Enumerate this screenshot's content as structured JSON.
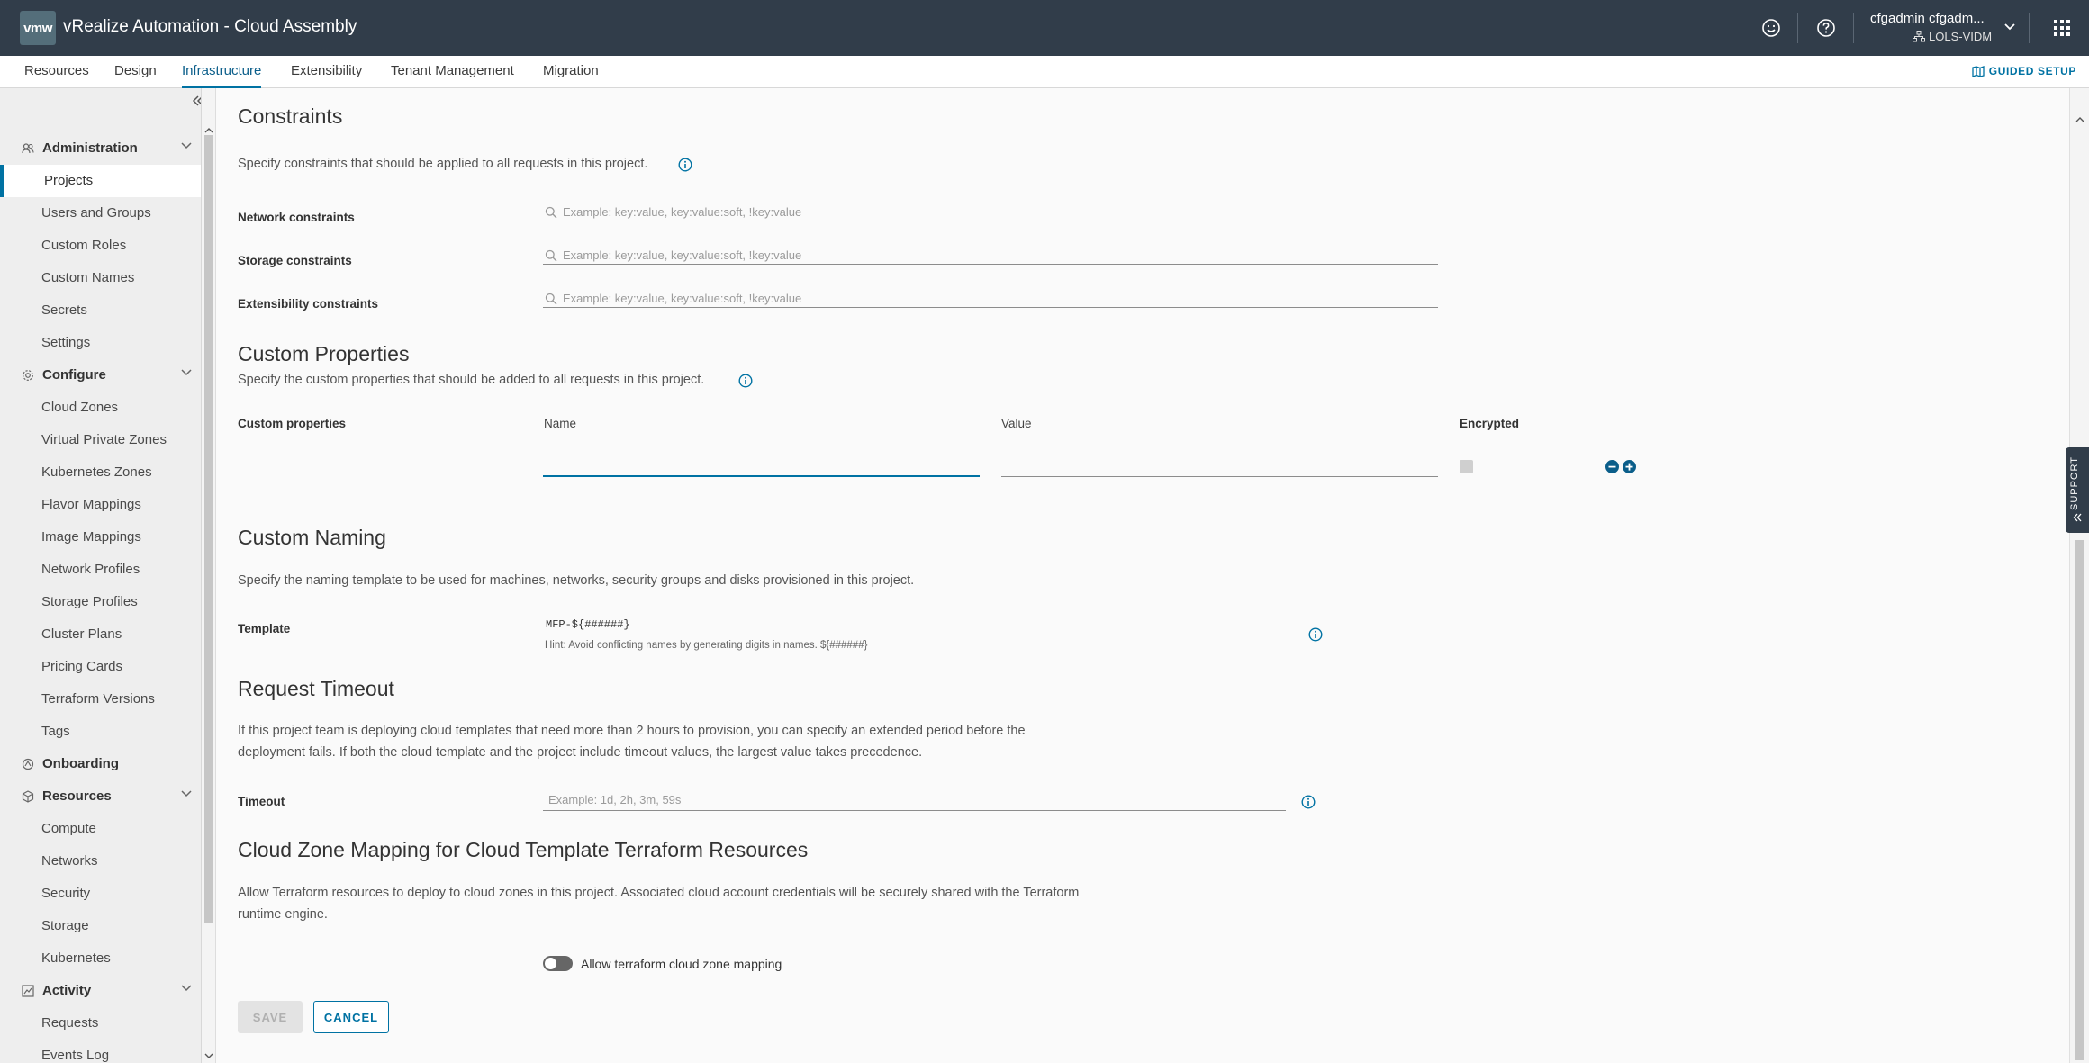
{
  "header": {
    "logo": "vmw",
    "title": "vRealize Automation - Cloud Assembly",
    "user_name": "cfgadmin cfgadm...",
    "user_org": "LOLS-VIDM"
  },
  "nav": {
    "tabs": [
      "Resources",
      "Design",
      "Infrastructure",
      "Extensibility",
      "Tenant Management",
      "Migration"
    ],
    "active": "Infrastructure",
    "guided_setup": "GUIDED SETUP"
  },
  "sidebar": {
    "administration": {
      "label": "Administration",
      "items": [
        "Projects",
        "Users and Groups",
        "Custom Roles",
        "Custom Names",
        "Secrets",
        "Settings"
      ]
    },
    "configure": {
      "label": "Configure",
      "items": [
        "Cloud Zones",
        "Virtual Private Zones",
        "Kubernetes Zones",
        "Flavor Mappings",
        "Image Mappings",
        "Network Profiles",
        "Storage Profiles",
        "Cluster Plans",
        "Pricing Cards",
        "Terraform Versions",
        "Tags"
      ]
    },
    "onboarding": {
      "label": "Onboarding"
    },
    "resources": {
      "label": "Resources",
      "items": [
        "Compute",
        "Networks",
        "Security",
        "Storage",
        "Kubernetes"
      ]
    },
    "activity": {
      "label": "Activity",
      "items": [
        "Requests",
        "Events Log"
      ]
    }
  },
  "constraints": {
    "title": "Constraints",
    "desc": "Specify constraints that should be applied to all requests in this project.",
    "network_label": "Network constraints",
    "storage_label": "Storage constraints",
    "extensibility_label": "Extensibility constraints",
    "placeholder": "Example: key:value, key:value:soft, !key:value"
  },
  "custom_properties": {
    "title": "Custom Properties",
    "desc": "Specify the custom properties that should be added to all requests in this project.",
    "label": "Custom properties",
    "col_name": "Name",
    "col_value": "Value",
    "col_encrypted": "Encrypted"
  },
  "custom_naming": {
    "title": "Custom Naming",
    "desc": "Specify the naming template to be used for machines, networks, security groups and disks provisioned in this project.",
    "template_label": "Template",
    "template_value": "MFP-${######}",
    "hint": "Hint: Avoid conflicting names by generating digits in names. ${######}"
  },
  "request_timeout": {
    "title": "Request Timeout",
    "desc_line1": "If this project team is deploying cloud templates that need more than 2 hours to provision, you can specify an extended period before the",
    "desc_line2": "deployment fails. If both the cloud template and the project include timeout values, the largest value takes precedence.",
    "label": "Timeout",
    "placeholder": "Example: 1d, 2h, 3m, 59s"
  },
  "cloud_zone_mapping": {
    "title": "Cloud Zone Mapping for Cloud Template Terraform Resources",
    "desc_line1": "Allow Terraform resources to deploy to cloud zones in this project. Associated cloud account credentials will be securely shared with the Terraform",
    "desc_line2": "runtime engine.",
    "toggle_label": "Allow terraform cloud zone mapping",
    "toggle_on": false
  },
  "actions": {
    "save": "SAVE",
    "cancel": "CANCEL"
  },
  "support": "SUPPORT",
  "colors": {
    "header_bg": "#313d4a",
    "accent": "#0072a3",
    "sidebar_bg": "#eeeeee"
  }
}
